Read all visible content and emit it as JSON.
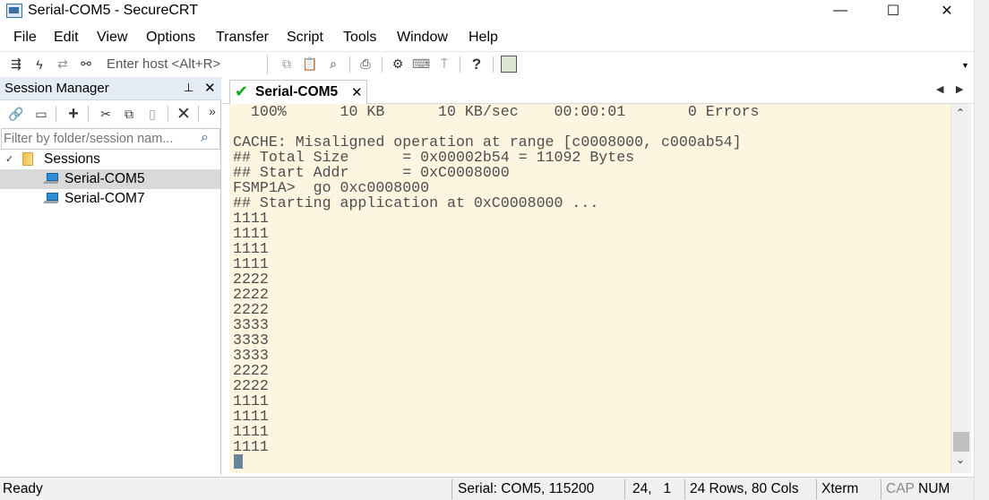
{
  "window": {
    "title": "Serial-COM5 - SecureCRT",
    "minimize_glyph": "—",
    "maximize_glyph": "☐",
    "close_glyph": "✕"
  },
  "menu": [
    "File",
    "Edit",
    "View",
    "Options",
    "Transfer",
    "Script",
    "Tools",
    "Window",
    "Help"
  ],
  "toolbar": {
    "quick_connect_placeholder": "Enter host <Alt+R>",
    "icons": [
      "connect-icon",
      "quick-connect-icon",
      "reconnect-icon",
      "disconnect-icon",
      "copy-icon",
      "paste-icon",
      "find-icon",
      "print-icon",
      "settings-icon",
      "keymap-icon",
      "sftp-icon",
      "help-icon",
      "app-icon"
    ]
  },
  "session_manager": {
    "title": "Session Manager",
    "pin_glyph": "📌",
    "close_glyph": "✕",
    "filter_placeholder": "Filter by folder/session nam...",
    "tree": {
      "folder": "Sessions",
      "sessions": [
        "Serial-COM5",
        "Serial-COM7"
      ],
      "selected": "Serial-COM5"
    }
  },
  "tabs": [
    {
      "label": "Serial-COM5",
      "active": true,
      "status": "connected"
    }
  ],
  "terminal": {
    "lines": [
      "  100%      10 KB      10 KB/sec    00:00:01       0 Errors",
      "",
      "CACHE: Misaligned operation at range [c0008000, c000ab54]",
      "## Total Size      = 0x00002b54 = 11092 Bytes",
      "## Start Addr      = 0xC0008000",
      "FSMP1A>  go 0xc0008000",
      "## Starting application at 0xC0008000 ...",
      "1111",
      "1111",
      "1111",
      "1111",
      "2222",
      "2222",
      "2222",
      "3333",
      "3333",
      "3333",
      "2222",
      "2222",
      "1111",
      "1111",
      "1111",
      "1111"
    ],
    "background": "#fdf5e0",
    "text_color": "#4e4e4e"
  },
  "status_bar": {
    "ready": "Ready",
    "connection": "Serial: COM5, 115200",
    "cursor_pos": "24,   1",
    "size": "24 Rows, 80 Cols",
    "terminal_type": "Xterm",
    "cap": "CAP",
    "num": "NUM"
  }
}
